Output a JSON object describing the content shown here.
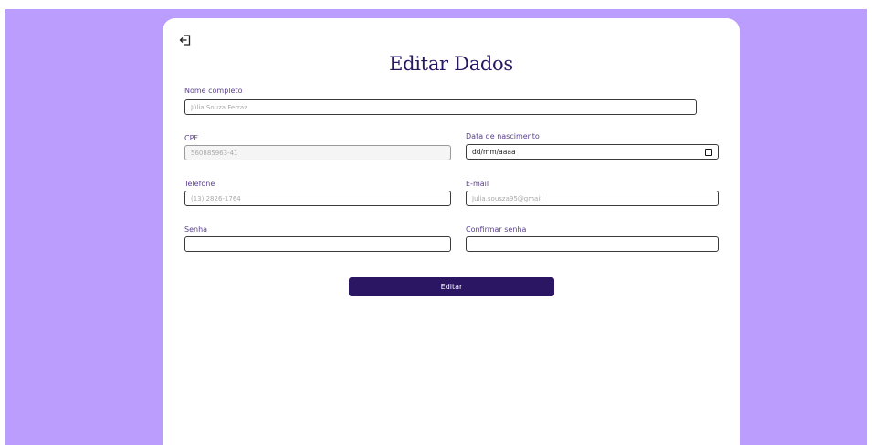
{
  "page": {
    "title": "Editar Dados",
    "back_icon": "exit-arrow-icon"
  },
  "form": {
    "full_name": {
      "label": "Nome completo",
      "placeholder": "Júlia Souza Ferraz"
    },
    "cpf": {
      "label": "CPF",
      "placeholder": "560885963-41"
    },
    "birth_date": {
      "label": "Data de nascimento",
      "value": "dd/mm/aaaa",
      "icon": "calendar-icon"
    },
    "phone": {
      "label": "Telefone",
      "placeholder": "(13) 2826-1764"
    },
    "email": {
      "label": "E-mail",
      "placeholder": "Julia.sousza95@gmail"
    },
    "password": {
      "label": "Senha",
      "placeholder": ""
    },
    "confirm_password": {
      "label": "Confirmar senha",
      "placeholder": ""
    },
    "submit_label": "Editar"
  },
  "colors": {
    "background": "#bb9dfd",
    "card": "#ffffff",
    "accent": "#2b1664",
    "title": "#2a1763",
    "label": "#5a3f8f"
  }
}
